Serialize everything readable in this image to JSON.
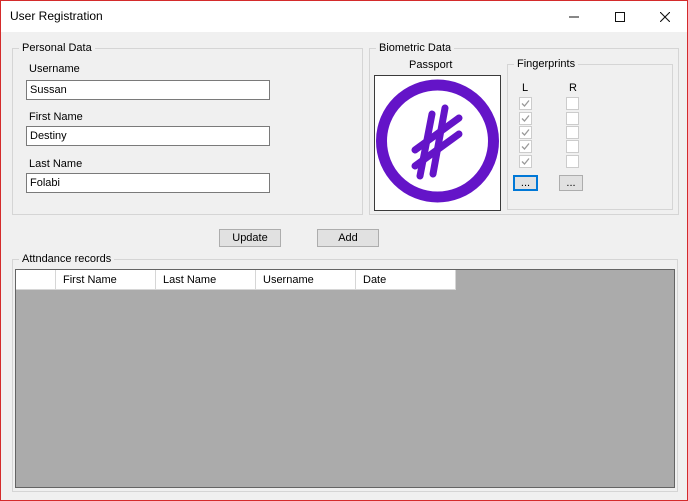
{
  "window": {
    "title": "User Registration",
    "controls": [
      "minimize",
      "maximize",
      "close"
    ]
  },
  "personal_data": {
    "group_label": "Personal Data",
    "username_label": "Username",
    "username_value": "Sussan",
    "first_name_label": "First Name",
    "first_name_value": "Destiny",
    "last_name_label": "Last Name",
    "last_name_value": "Folabi"
  },
  "biometric_data": {
    "group_label": "Biometric Data",
    "passport_label": "Passport",
    "passport_image_icon": "purple-circle-crossed-lines-icon",
    "fingerprints": {
      "group_label": "Fingerprints",
      "left_label": "L",
      "right_label": "R",
      "left_checked": [
        true,
        true,
        true,
        true,
        true
      ],
      "right_checked": [
        false,
        false,
        false,
        false,
        false
      ],
      "left_button_label": "...",
      "right_button_label": "..."
    }
  },
  "actions": {
    "update_label": "Update",
    "add_label": "Add"
  },
  "attendance": {
    "group_label": "Attndance records",
    "columns": [
      "",
      "First Name",
      "Last Name",
      "Username",
      "Date"
    ],
    "rows": []
  },
  "colors": {
    "window_border": "#d42b2b",
    "form_background": "#f0f0f0",
    "grid_background": "#ababab",
    "passport_icon": "#6414c8",
    "focus_accent": "#0078d7"
  }
}
